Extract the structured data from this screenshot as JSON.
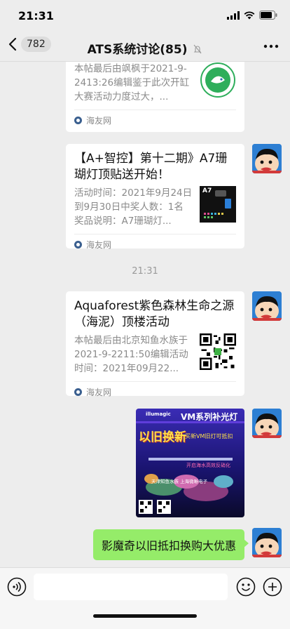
{
  "status": {
    "time": "21:31"
  },
  "nav": {
    "unread_count": "782",
    "title": "ATS系统讨论(85)"
  },
  "messages": [
    {
      "desc": "本帖最后由飒枫于2021-9-2413:26编辑鉴于此次开缸大赛活动力度过大，...",
      "source": "海友网"
    },
    {
      "title": "【A+智控】第十二期》A7珊瑚灯顶贴送开始！",
      "desc": "活动时间：2021年9月24日到9月30日中奖人数：1名奖品说明：A7珊瑚灯...",
      "thumb_label": "A7",
      "source": "海友网"
    },
    {
      "title": "Aquaforest紫色森林生命之源（海泥）顶楼活动",
      "desc": "本帖最后由北京知鱼水族于2021-9-2211:50编辑活动时间：2021年09月22...",
      "source": "海友网"
    },
    {
      "text": "影魔奇以旧抵扣换购大优惠"
    }
  ],
  "timestamp": "21:31",
  "promo_image": {
    "brand": "illumagic",
    "headline": "VM系列补光灯",
    "big_text": "以旧换新",
    "line1": "买新VM旧灯可抵扣",
    "line2": "开启海水高效反硝化",
    "line3": "天津知鱼水族 上海微晰电子"
  },
  "colors": {
    "bubble_green": "#95ec69",
    "background": "#ededed"
  }
}
